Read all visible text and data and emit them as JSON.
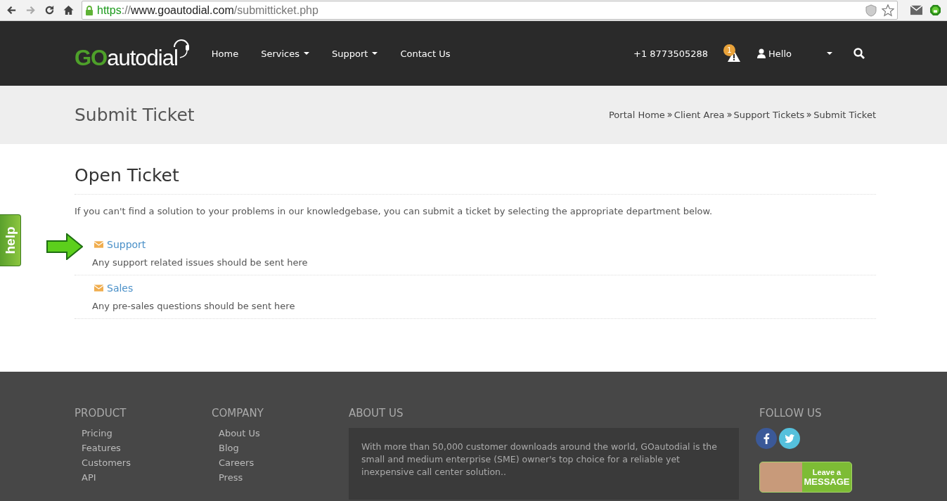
{
  "browser": {
    "url": {
      "scheme": "https",
      "separator": "://",
      "host": "www.goautodial.com",
      "path": "/submitticket.php"
    }
  },
  "navbar": {
    "logo": {
      "prefix": "GO",
      "text": "autodial"
    },
    "links": [
      {
        "label": "Home",
        "dropdown": false
      },
      {
        "label": "Services",
        "dropdown": true
      },
      {
        "label": "Support",
        "dropdown": true
      },
      {
        "label": "Contact Us",
        "dropdown": false
      }
    ],
    "phone": "+1 8773505288",
    "alert_count": "1",
    "user": "Hello"
  },
  "page_header": {
    "title": "Submit Ticket",
    "breadcrumb": [
      "Portal Home",
      "Client Area",
      "Support Tickets",
      "Submit Ticket"
    ]
  },
  "content": {
    "title": "Open Ticket",
    "intro": "If you can't find a solution to your problems in our knowledgebase, you can submit a ticket by selecting the appropriate department below.",
    "departments": [
      {
        "name": "Support",
        "description": "Any support related issues should be sent here",
        "pointed": true
      },
      {
        "name": "Sales",
        "description": "Any pre-sales questions should be sent here",
        "pointed": false
      }
    ]
  },
  "help_tab": "help",
  "footer": {
    "columns": [
      {
        "title": "PRODUCT",
        "links": [
          "Pricing",
          "Features",
          "Customers",
          "API"
        ]
      },
      {
        "title": "COMPANY",
        "links": [
          "About Us",
          "Blog",
          "Careers",
          "Press"
        ]
      }
    ],
    "about": {
      "title": "ABOUT US",
      "text": "With more than 50,000 customer downloads around the world, GOautodial is the small and medium enterprise (SME) owner's top choice for a reliable yet inexpensive call center solution.."
    },
    "follow": {
      "title": "FOLLOW US",
      "message_banner": {
        "line1": "Leave a",
        "line2": "MESSAGE"
      }
    }
  }
}
